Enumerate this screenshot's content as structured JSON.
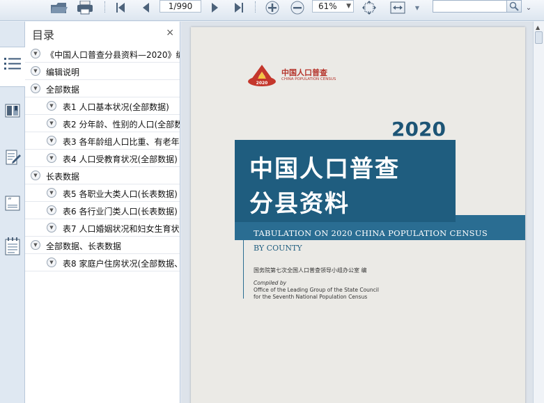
{
  "toolbar": {
    "page_value": "1/990",
    "zoom_value": "61%",
    "search_value": ""
  },
  "panel": {
    "title": "目录",
    "close_glyph": "×"
  },
  "outline": [
    {
      "level": 0,
      "label": "《中国人口普查分县资料—2020》编"
    },
    {
      "level": 0,
      "label": "编辑说明"
    },
    {
      "level": 0,
      "label": "全部数据"
    },
    {
      "level": 1,
      "label": "表1 人口基本状况(全部数据)"
    },
    {
      "level": 1,
      "label": "表2 分年龄、性别的人口(全部数"
    },
    {
      "level": 1,
      "label": "表3 各年龄组人口比重、有老年"
    },
    {
      "level": 1,
      "label": "表4 人口受教育状况(全部数据)"
    },
    {
      "level": 0,
      "label": "长表数据"
    },
    {
      "level": 1,
      "label": "表5 各职业大类人口(长表数据)"
    },
    {
      "level": 1,
      "label": "表6 各行业门类人口(长表数据)"
    },
    {
      "level": 1,
      "label": "表7 人口婚姻状况和妇女生育状"
    },
    {
      "level": 0,
      "label": "全部数据、长表数据"
    },
    {
      "level": 1,
      "label": "表8 家庭户住房状况(全部数据、"
    }
  ],
  "cover": {
    "logo_cn": "中国人口普查",
    "logo_en": "CHINA POPULATION CENSUS",
    "logo_year": "2020",
    "year": "2020",
    "title_line1": "中国人口普查",
    "title_line2": "分县资料",
    "en_title": "TABULATION ON 2020 CHINA POPULATION CENSUS",
    "en_subtitle": "BY COUNTY",
    "org_cn": "国务院第七次全国人口普查领导小组办公室  编",
    "org_en_compiled": "Compiled by",
    "org_en_line1": "Office of the Leading Group of the State Council",
    "org_en_line2": "for the Seventh National Population Census"
  },
  "colors": {
    "accent_blue": "#1f5d7f",
    "logo_red": "#b5332a"
  }
}
